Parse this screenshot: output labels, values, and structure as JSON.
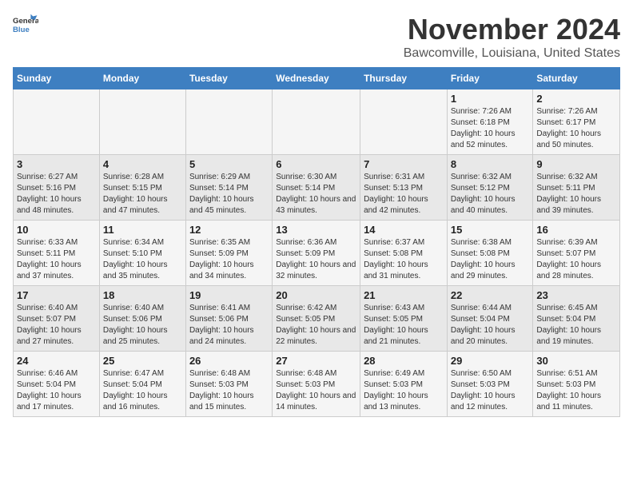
{
  "header": {
    "logo_line1": "General",
    "logo_line2": "Blue",
    "month_title": "November 2024",
    "location": "Bawcomville, Louisiana, United States"
  },
  "weekdays": [
    "Sunday",
    "Monday",
    "Tuesday",
    "Wednesday",
    "Thursday",
    "Friday",
    "Saturday"
  ],
  "weeks": [
    [
      {
        "day": "",
        "info": ""
      },
      {
        "day": "",
        "info": ""
      },
      {
        "day": "",
        "info": ""
      },
      {
        "day": "",
        "info": ""
      },
      {
        "day": "",
        "info": ""
      },
      {
        "day": "1",
        "info": "Sunrise: 7:26 AM\nSunset: 6:18 PM\nDaylight: 10 hours\nand 52 minutes."
      },
      {
        "day": "2",
        "info": "Sunrise: 7:26 AM\nSunset: 6:17 PM\nDaylight: 10 hours\nand 50 minutes."
      }
    ],
    [
      {
        "day": "3",
        "info": "Sunrise: 6:27 AM\nSunset: 5:16 PM\nDaylight: 10 hours\nand 48 minutes."
      },
      {
        "day": "4",
        "info": "Sunrise: 6:28 AM\nSunset: 5:15 PM\nDaylight: 10 hours\nand 47 minutes."
      },
      {
        "day": "5",
        "info": "Sunrise: 6:29 AM\nSunset: 5:14 PM\nDaylight: 10 hours\nand 45 minutes."
      },
      {
        "day": "6",
        "info": "Sunrise: 6:30 AM\nSunset: 5:14 PM\nDaylight: 10 hours\nand 43 minutes."
      },
      {
        "day": "7",
        "info": "Sunrise: 6:31 AM\nSunset: 5:13 PM\nDaylight: 10 hours\nand 42 minutes."
      },
      {
        "day": "8",
        "info": "Sunrise: 6:32 AM\nSunset: 5:12 PM\nDaylight: 10 hours\nand 40 minutes."
      },
      {
        "day": "9",
        "info": "Sunrise: 6:32 AM\nSunset: 5:11 PM\nDaylight: 10 hours\nand 39 minutes."
      }
    ],
    [
      {
        "day": "10",
        "info": "Sunrise: 6:33 AM\nSunset: 5:11 PM\nDaylight: 10 hours\nand 37 minutes."
      },
      {
        "day": "11",
        "info": "Sunrise: 6:34 AM\nSunset: 5:10 PM\nDaylight: 10 hours\nand 35 minutes."
      },
      {
        "day": "12",
        "info": "Sunrise: 6:35 AM\nSunset: 5:09 PM\nDaylight: 10 hours\nand 34 minutes."
      },
      {
        "day": "13",
        "info": "Sunrise: 6:36 AM\nSunset: 5:09 PM\nDaylight: 10 hours\nand 32 minutes."
      },
      {
        "day": "14",
        "info": "Sunrise: 6:37 AM\nSunset: 5:08 PM\nDaylight: 10 hours\nand 31 minutes."
      },
      {
        "day": "15",
        "info": "Sunrise: 6:38 AM\nSunset: 5:08 PM\nDaylight: 10 hours\nand 29 minutes."
      },
      {
        "day": "16",
        "info": "Sunrise: 6:39 AM\nSunset: 5:07 PM\nDaylight: 10 hours\nand 28 minutes."
      }
    ],
    [
      {
        "day": "17",
        "info": "Sunrise: 6:40 AM\nSunset: 5:07 PM\nDaylight: 10 hours\nand 27 minutes."
      },
      {
        "day": "18",
        "info": "Sunrise: 6:40 AM\nSunset: 5:06 PM\nDaylight: 10 hours\nand 25 minutes."
      },
      {
        "day": "19",
        "info": "Sunrise: 6:41 AM\nSunset: 5:06 PM\nDaylight: 10 hours\nand 24 minutes."
      },
      {
        "day": "20",
        "info": "Sunrise: 6:42 AM\nSunset: 5:05 PM\nDaylight: 10 hours\nand 22 minutes."
      },
      {
        "day": "21",
        "info": "Sunrise: 6:43 AM\nSunset: 5:05 PM\nDaylight: 10 hours\nand 21 minutes."
      },
      {
        "day": "22",
        "info": "Sunrise: 6:44 AM\nSunset: 5:04 PM\nDaylight: 10 hours\nand 20 minutes."
      },
      {
        "day": "23",
        "info": "Sunrise: 6:45 AM\nSunset: 5:04 PM\nDaylight: 10 hours\nand 19 minutes."
      }
    ],
    [
      {
        "day": "24",
        "info": "Sunrise: 6:46 AM\nSunset: 5:04 PM\nDaylight: 10 hours\nand 17 minutes."
      },
      {
        "day": "25",
        "info": "Sunrise: 6:47 AM\nSunset: 5:04 PM\nDaylight: 10 hours\nand 16 minutes."
      },
      {
        "day": "26",
        "info": "Sunrise: 6:48 AM\nSunset: 5:03 PM\nDaylight: 10 hours\nand 15 minutes."
      },
      {
        "day": "27",
        "info": "Sunrise: 6:48 AM\nSunset: 5:03 PM\nDaylight: 10 hours\nand 14 minutes."
      },
      {
        "day": "28",
        "info": "Sunrise: 6:49 AM\nSunset: 5:03 PM\nDaylight: 10 hours\nand 13 minutes."
      },
      {
        "day": "29",
        "info": "Sunrise: 6:50 AM\nSunset: 5:03 PM\nDaylight: 10 hours\nand 12 minutes."
      },
      {
        "day": "30",
        "info": "Sunrise: 6:51 AM\nSunset: 5:03 PM\nDaylight: 10 hours\nand 11 minutes."
      }
    ]
  ]
}
